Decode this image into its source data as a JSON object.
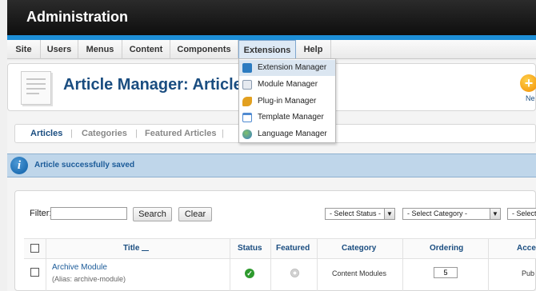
{
  "header": {
    "title": "Administration"
  },
  "menu": {
    "items": [
      "Site",
      "Users",
      "Menus",
      "Content",
      "Components",
      "Extensions",
      "Help"
    ],
    "active": "Extensions"
  },
  "extensions_menu": {
    "items": [
      {
        "label": "Extension Manager",
        "icon": "extension-manager-icon",
        "color": "#2c7bc0"
      },
      {
        "label": "Module Manager",
        "icon": "module-manager-icon",
        "color": "#8a9bb0"
      },
      {
        "label": "Plug-in Manager",
        "icon": "plugin-manager-icon",
        "color": "#e2a020"
      },
      {
        "label": "Template Manager",
        "icon": "template-manager-icon",
        "color": "#4f8ad1"
      },
      {
        "label": "Language Manager",
        "icon": "language-manager-icon",
        "color": "#3a7fc5"
      }
    ]
  },
  "page": {
    "title": "Article Manager: Articles",
    "new_label": "Ne"
  },
  "subnav": {
    "tabs": [
      "Articles",
      "Categories",
      "Featured Articles"
    ],
    "active": "Articles"
  },
  "message": {
    "text": "Article successfully saved"
  },
  "filter": {
    "label": "Filter:",
    "value": "",
    "search_button": "Search",
    "clear_button": "Clear",
    "status_select": "- Select Status -",
    "category_select": "- Select Category -",
    "third_select": "- Select"
  },
  "table": {
    "columns": [
      "Title",
      "Status",
      "Featured",
      "Category",
      "Ordering",
      "Acce"
    ],
    "rows": [
      {
        "title": "Archive Module",
        "alias": "(Alias: archive-module)",
        "status": "published",
        "featured": false,
        "category": "Content Modules",
        "ordering": "5",
        "access": "Pub"
      }
    ]
  },
  "colors": {
    "accent": "#1d8ed6",
    "brand_blue": "#1a4d80",
    "message_bg": "#bfd6ea"
  }
}
